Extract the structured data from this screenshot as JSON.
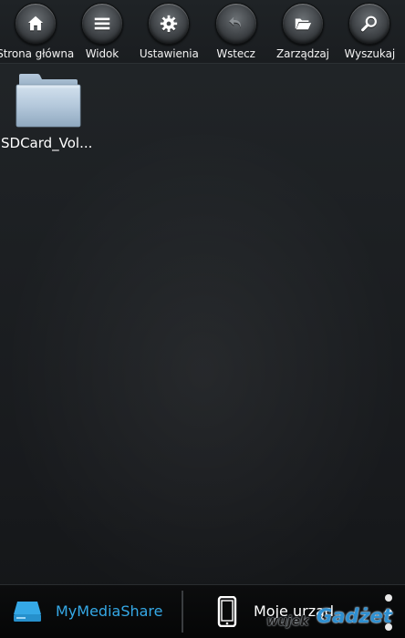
{
  "toolbar": {
    "items": [
      {
        "label": "Strona główna",
        "icon": "home-icon"
      },
      {
        "label": "Widok",
        "icon": "list-icon"
      },
      {
        "label": "Ustawienia",
        "icon": "gear-icon"
      },
      {
        "label": "Wstecz",
        "icon": "back-arrow-icon"
      },
      {
        "label": "Zarządzaj",
        "icon": "open-folder-icon"
      },
      {
        "label": "Wyszukaj",
        "icon": "search-icon"
      }
    ]
  },
  "files": [
    {
      "name": "SDCard_Vol...",
      "icon": "folder-icon"
    }
  ],
  "bottom_bar": {
    "media_share_label": "MyMediaShare",
    "my_devices_label": "Moje urząd",
    "media_share_icon": "media-drive-icon",
    "my_devices_icon": "phone-icon",
    "overflow_icon": "overflow-menu-icon",
    "accent_color": "#35a8e6"
  },
  "watermark": {
    "part1": "wujek",
    "part2": "Gadżet"
  }
}
